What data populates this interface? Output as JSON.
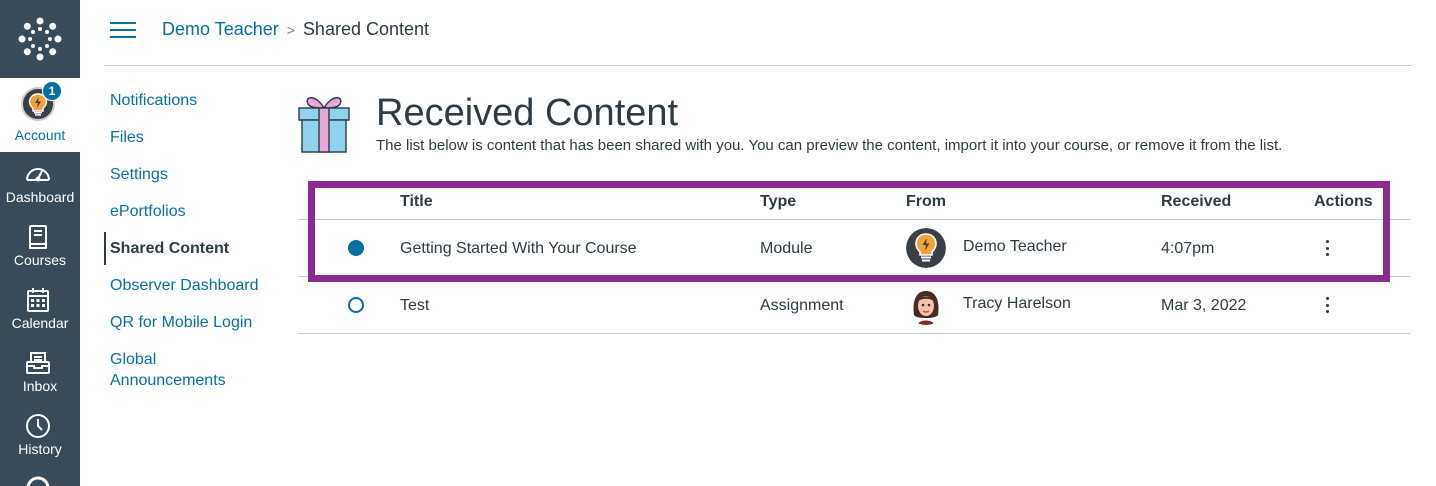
{
  "global_nav": {
    "logo": {
      "icon": "canvas-logo-icon"
    },
    "account": {
      "label": "Account",
      "badge_count": "1",
      "icon": "lightbulb-avatar-icon"
    },
    "items": [
      {
        "label": "Dashboard",
        "icon": "dashboard-icon"
      },
      {
        "label": "Courses",
        "icon": "courses-icon"
      },
      {
        "label": "Calendar",
        "icon": "calendar-icon"
      },
      {
        "label": "Inbox",
        "icon": "inbox-icon"
      },
      {
        "label": "History",
        "icon": "history-icon"
      }
    ],
    "colors": {
      "background": "#394b58",
      "accent": "#0770a3"
    }
  },
  "header": {
    "breadcrumb": {
      "parent": "Demo Teacher",
      "separator": ">",
      "current": "Shared Content"
    }
  },
  "left_menu": {
    "items": [
      {
        "label": "Notifications",
        "active": false
      },
      {
        "label": "Files",
        "active": false
      },
      {
        "label": "Settings",
        "active": false
      },
      {
        "label": "ePortfolios",
        "active": false
      },
      {
        "label": "Shared Content",
        "active": true
      },
      {
        "label": "Observer Dashboard",
        "active": false
      },
      {
        "label": "QR for Mobile Login",
        "active": false
      },
      {
        "label": "Global Announcements",
        "active": false
      }
    ]
  },
  "main": {
    "title": "Received Content",
    "description": "The list below is content that has been shared with you. You can preview the content, import it into your course, or remove it from the list.",
    "table": {
      "columns": [
        "Title",
        "Type",
        "From",
        "Received",
        "Actions"
      ],
      "rows": [
        {
          "read": false,
          "title": "Getting Started With Your Course",
          "type": "Module",
          "from": "Demo Teacher",
          "received": "4:07pm"
        },
        {
          "read": true,
          "title": "Test",
          "type": "Assignment",
          "from": "Tracy Harelson",
          "received": "Mar 3, 2022"
        }
      ]
    },
    "highlight_color": "#8a2b8f"
  }
}
